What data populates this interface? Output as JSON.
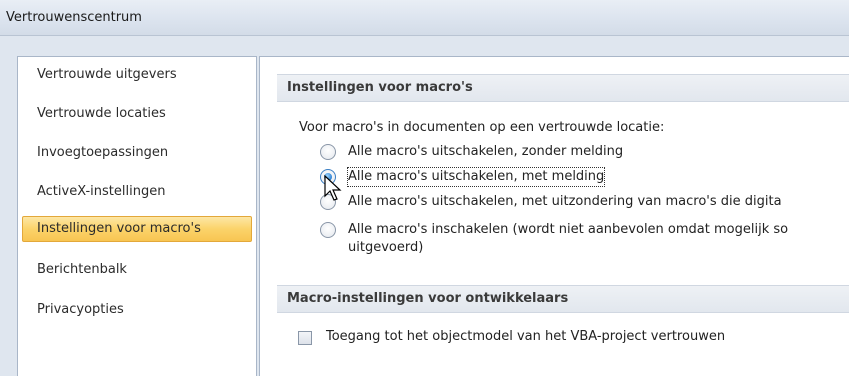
{
  "window": {
    "title": "Vertrouwenscentrum"
  },
  "sidebar": {
    "items": [
      {
        "label": "Vertrouwde uitgevers",
        "selected": false
      },
      {
        "label": "Vertrouwde locaties",
        "selected": false
      },
      {
        "label": "Invoegtoepassingen",
        "selected": false
      },
      {
        "label": "ActiveX-instellingen",
        "selected": false
      },
      {
        "label": "Instellingen voor macro's",
        "selected": true
      },
      {
        "label": "Berichtenbalk",
        "selected": false
      },
      {
        "label": "Privacyopties",
        "selected": false
      }
    ]
  },
  "main": {
    "macro_section": {
      "header": "Instellingen voor macro's",
      "prompt": "Voor macro's in documenten op een vertrouwde locatie:",
      "options": [
        {
          "label": "Alle macro's uitschakelen, zonder melding",
          "checked": false
        },
        {
          "label": "Alle macro's uitschakelen, met melding",
          "checked": true
        },
        {
          "label": "Alle macro's uitschakelen, met uitzondering van macro's die digita",
          "checked": false
        },
        {
          "label": "Alle macro's inschakelen (wordt niet aanbevolen omdat mogelijk so",
          "label_line2": "uitgevoerd)",
          "checked": false
        }
      ]
    },
    "developer_section": {
      "header": "Macro-instellingen voor ontwikkelaars",
      "checkbox_label": "Toegang tot het objectmodel van het VBA-project vertrouwen",
      "checked": false
    }
  },
  "colors": {
    "selected_bg": "#fbd36a",
    "selected_border": "#e3a83a",
    "frame_bg": "#dfe6ef",
    "radio_checked": "#2c7fd0"
  }
}
